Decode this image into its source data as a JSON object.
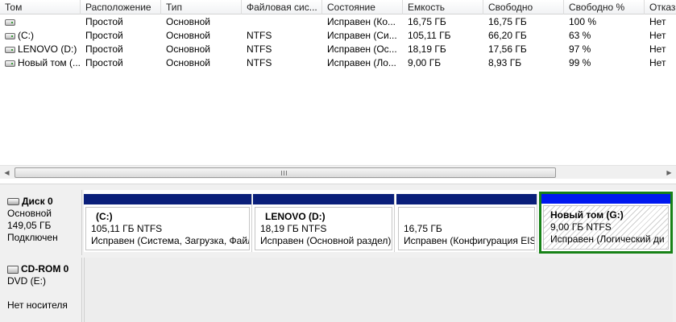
{
  "columns": [
    "Том",
    "Расположение",
    "Тип",
    "Файловая сис...",
    "Состояние",
    "Емкость",
    "Свободно",
    "Свободно %",
    "Отказ"
  ],
  "volumes": [
    {
      "name": "",
      "layout": "Простой",
      "type": "Основной",
      "fs": "",
      "status": "Исправен (Ко...",
      "capacity": "16,75 ГБ",
      "free": "16,75 ГБ",
      "free_pct": "100 %",
      "fault": "Нет"
    },
    {
      "name": "(C:)",
      "layout": "Простой",
      "type": "Основной",
      "fs": "NTFS",
      "status": "Исправен (Си...",
      "capacity": "105,11 ГБ",
      "free": "66,20 ГБ",
      "free_pct": "63 %",
      "fault": "Нет"
    },
    {
      "name": "LENOVO (D:)",
      "layout": "Простой",
      "type": "Основной",
      "fs": "NTFS",
      "status": "Исправен (Ос...",
      "capacity": "18,19 ГБ",
      "free": "17,56 ГБ",
      "free_pct": "97 %",
      "fault": "Нет"
    },
    {
      "name": "Новый том (...",
      "layout": "Простой",
      "type": "Основной",
      "fs": "NTFS",
      "status": "Исправен (Ло...",
      "capacity": "9,00 ГБ",
      "free": "8,93 ГБ",
      "free_pct": "99 %",
      "fault": "Нет"
    }
  ],
  "scrollbar": {
    "grip_icon": "grip-icon",
    "left_arrow": "◀",
    "right_arrow": "▶"
  },
  "disk0": {
    "title": "Диск 0",
    "type": "Основной",
    "size": "149,05 ГБ",
    "state": "Подключен",
    "partitions": [
      {
        "name": "(C:)",
        "size": "105,11 ГБ NTFS",
        "status": "Исправен (Система, Загрузка, Файл",
        "color": "#0a1f7a"
      },
      {
        "name": "LENOVO  (D:)",
        "size": "18,19 ГБ NTFS",
        "status": "Исправен (Основной раздел)",
        "color": "#0a1f7a"
      },
      {
        "name": "",
        "size": "16,75 ГБ",
        "status": "Исправен (Конфигурация EIS",
        "color": "#0a1f7a"
      },
      {
        "name": "Новый том  (G:)",
        "size": "9,00 ГБ NTFS",
        "status": "Исправен (Логический ди",
        "color": "#0018f0"
      }
    ]
  },
  "cdrom0": {
    "title": "CD-ROM 0",
    "drive": "DVD (E:)",
    "media": "Нет носителя"
  },
  "colors": {
    "primary_bar": "#0a1f7a",
    "logical_bar": "#0018f0",
    "selection_border": "#178217"
  }
}
